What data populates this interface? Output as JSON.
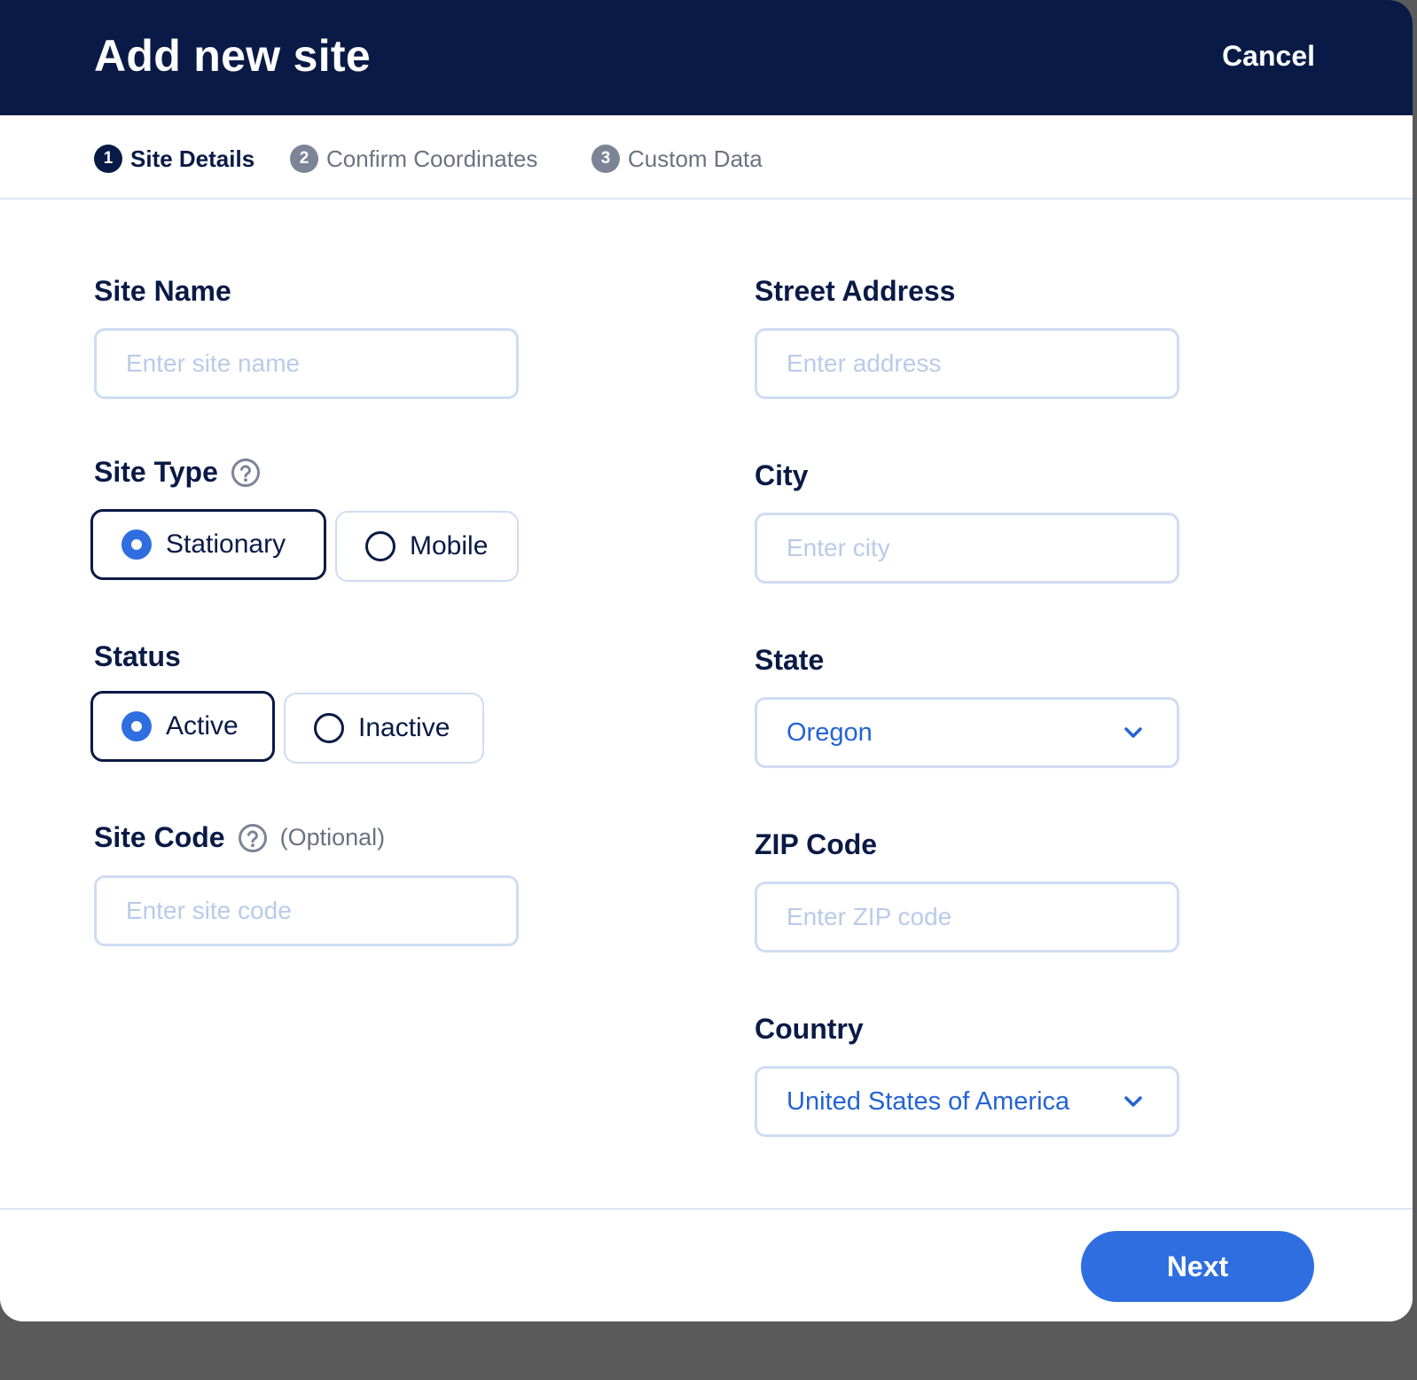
{
  "header": {
    "title": "Add new site",
    "cancel_label": "Cancel"
  },
  "steps": [
    {
      "number": "1",
      "label": "Site Details",
      "active": true
    },
    {
      "number": "2",
      "label": "Confirm Coordinates",
      "active": false
    },
    {
      "number": "3",
      "label": "Custom Data",
      "active": false
    }
  ],
  "left": {
    "site_name": {
      "label": "Site Name",
      "placeholder": "Enter site name",
      "value": ""
    },
    "site_type": {
      "label": "Site Type",
      "help_icon": "question-circle-icon",
      "options": [
        "Stationary",
        "Mobile"
      ],
      "selected": "Stationary"
    },
    "status": {
      "label": "Status",
      "options": [
        "Active",
        "Inactive"
      ],
      "selected": "Active"
    },
    "site_code": {
      "label": "Site Code",
      "help_icon": "question-circle-icon",
      "optional_label": "(Optional)",
      "placeholder": "Enter site code",
      "value": ""
    }
  },
  "right": {
    "street_address": {
      "label": "Street Address",
      "placeholder": "Enter address",
      "value": ""
    },
    "city": {
      "label": "City",
      "placeholder": "Enter city",
      "value": ""
    },
    "state": {
      "label": "State",
      "value": "Oregon"
    },
    "zip": {
      "label": "ZIP Code",
      "placeholder": "Enter ZIP code",
      "value": ""
    },
    "country": {
      "label": "Country",
      "value": "United States of America"
    }
  },
  "footer": {
    "next_label": "Next"
  },
  "colors": {
    "header_bg": "#0a1a46",
    "accent": "#2f6ee0",
    "input_border": "#cfdcf3",
    "placeholder": "#b9cbe9",
    "backdrop": "#5a5a5a"
  }
}
